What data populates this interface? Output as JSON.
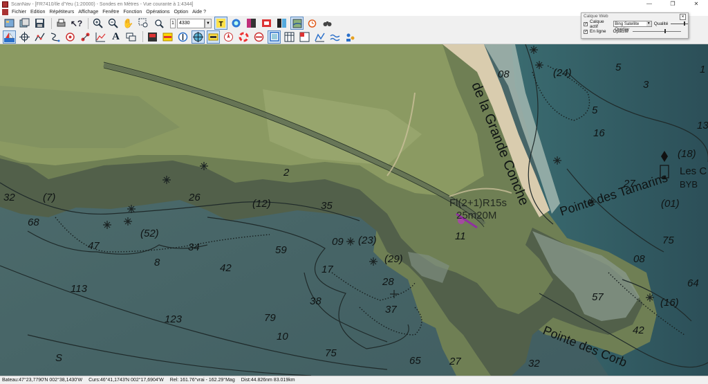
{
  "window": {
    "title": "ScanNav - [FR7410/Ile d'Yeu (1:20000) - Sondes en  Mètres - Vue courante à 1:4344]"
  },
  "menu": [
    "Fichier",
    "Edition",
    "Répétiteurs",
    "Affichage",
    "Fenêtre",
    "Fonction",
    "Opérations",
    "Option",
    "Aide ?"
  ],
  "toolbar": {
    "scale_value": "4330"
  },
  "web_layer": {
    "title": "Calque Web",
    "active_label": "Calque actif",
    "source": "Bing Satellite Overlay",
    "quality_label": "Qualité",
    "online_label": "En ligne",
    "opacity_label": "Opacité"
  },
  "status": {
    "boat": "Bateau:47°23,7790'N 002°38,1430'W",
    "cursor": "Curs:46°41,1743'N 002°17,6904'W",
    "relative": "Rel: 161.76°vrai - 162.29°Mag",
    "distance": "Dist:44.826nm  83.019km"
  },
  "chart": {
    "labels": [
      "de la Grande Conche",
      "Pointe des Tamarins",
      "Pointe des Corb",
      "Les C",
      "BYB",
      "Fl(2+1)R15s",
      "25m20M"
    ],
    "soundings": [
      "5",
      "3",
      "1",
      "32",
      "(7)",
      "68",
      "47",
      "8",
      "113",
      "123",
      "2",
      "26",
      "(12)",
      "(52)",
      "34",
      "42",
      "35",
      "59",
      "09",
      "(23)",
      "(29)",
      "17",
      "28",
      "38",
      "37",
      "79",
      "10",
      "75",
      "65",
      "27",
      "S",
      "(24)",
      "08",
      "5",
      "16",
      "13",
      "(18)",
      "27",
      "(01)",
      "75",
      "08",
      "64",
      "57",
      "(16)",
      "42",
      "32",
      "11"
    ]
  }
}
